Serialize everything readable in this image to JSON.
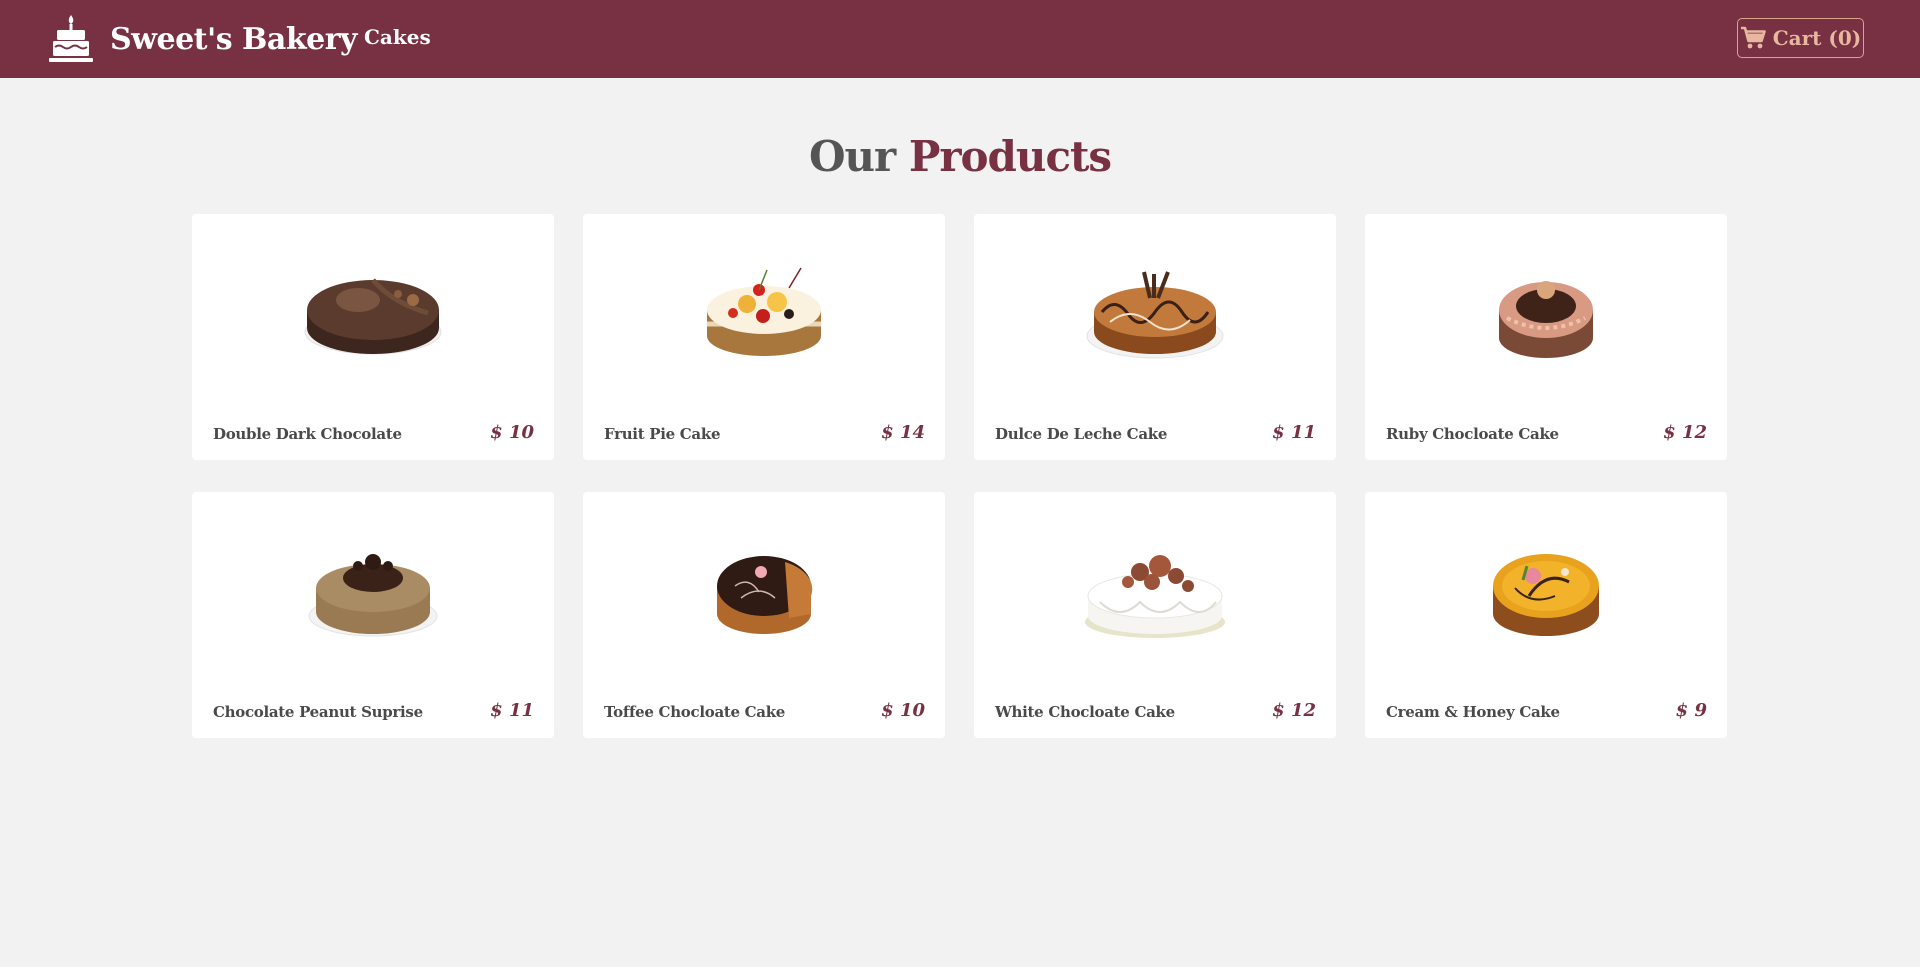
{
  "navbar": {
    "brand_name": "Sweet's Bakery",
    "brand_icon": "cake-icon",
    "nav_link": "Cakes",
    "cart_icon": "shopping-cart-icon",
    "cart_label": "Cart (0)"
  },
  "heading": {
    "part1": "Our",
    "part2": "Products"
  },
  "products": [
    {
      "name": "Double Dark Chocolate",
      "price": "$ 10",
      "image": "double-dark-chocolate-cake-image"
    },
    {
      "name": "Fruit Pie Cake",
      "price": "$ 14",
      "image": "fruit-pie-cake-image"
    },
    {
      "name": "Dulce De Leche Cake",
      "price": "$ 11",
      "image": "dulce-de-leche-cake-image"
    },
    {
      "name": "Ruby Chocloate Cake",
      "price": "$ 12",
      "image": "ruby-chocolate-cake-image"
    },
    {
      "name": "Chocolate Peanut Suprise",
      "price": "$ 11",
      "image": "chocolate-peanut-cake-image"
    },
    {
      "name": "Toffee Chocloate Cake",
      "price": "$ 10",
      "image": "toffee-chocolate-cake-image"
    },
    {
      "name": "White Chocloate Cake",
      "price": "$ 12",
      "image": "white-chocolate-cake-image"
    },
    {
      "name": "Cream & Honey Cake",
      "price": "$ 9",
      "image": "cream-honey-cake-image"
    }
  ],
  "colors": {
    "brand": "#773142",
    "background": "#f2f2f2",
    "card": "#ffffff",
    "cart_accent": "#e7b79f"
  }
}
